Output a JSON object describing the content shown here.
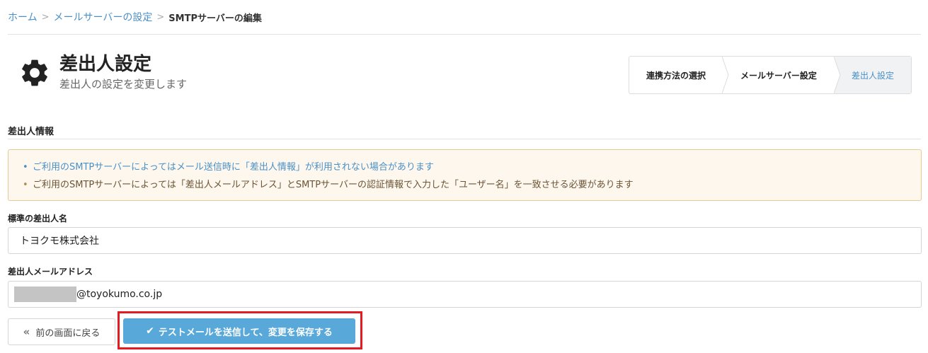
{
  "breadcrumb": {
    "home": "ホーム",
    "mail_server_settings": "メールサーバーの設定",
    "current": "SMTPサーバーの編集",
    "separator": ">"
  },
  "header": {
    "icon": "gear-icon",
    "title": "差出人設定",
    "subtitle": "差出人の設定を変更します"
  },
  "stepper": {
    "steps": [
      {
        "label": "連携方法の選択",
        "active": false
      },
      {
        "label": "メールサーバー設定",
        "active": false
      },
      {
        "label": "差出人設定",
        "active": true
      }
    ]
  },
  "section": {
    "title": "差出人情報"
  },
  "alert": {
    "items": [
      "ご利用のSMTPサーバーによってはメール送信時に「差出人情報」が利用されない場合があります",
      "ご利用のSMTPサーバーによっては「差出人メールアドレス」とSMTPサーバーの認証情報で入力した「ユーザー名」を一致させる必要があります"
    ]
  },
  "form": {
    "sender_name_label": "標準の差出人名",
    "sender_name_value": "トヨクモ株式会社",
    "sender_email_label": "差出人メールアドレス",
    "sender_email_domain": "@toyokumo.co.jp"
  },
  "actions": {
    "back_icon": "double-chevron-left-icon",
    "back_label": "前の画面に戻る",
    "submit_icon": "check-icon",
    "submit_label": "テストメールを送信して、変更を保存する"
  },
  "colors": {
    "link": "#4a90c8",
    "primary_button": "#58a9d9",
    "highlight": "#e31b23",
    "alert_bg": "#fdf7ee",
    "alert_border": "#e8c995"
  }
}
